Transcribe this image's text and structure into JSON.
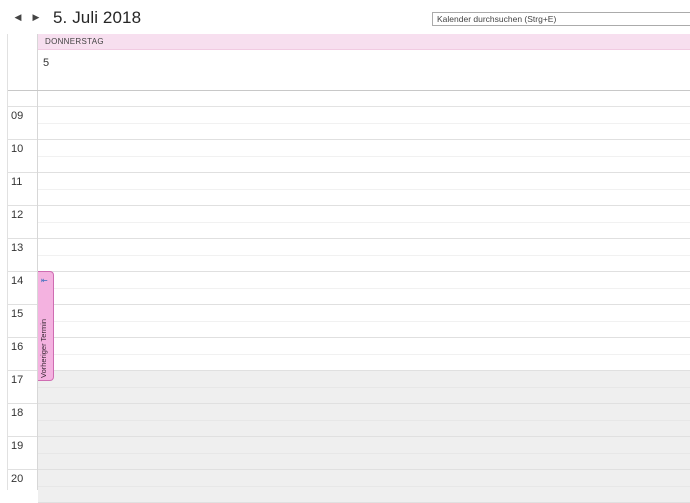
{
  "header": {
    "title": "5. Juli 2018",
    "prev_icon": "triangle-left-icon",
    "next_icon": "triangle-right-icon",
    "search_placeholder": "Kalender durchsuchen (Strg+E)"
  },
  "day": {
    "name": "DONNERSTAG",
    "number": "5",
    "header_color": "#f7dfef"
  },
  "hours": [
    "09",
    "10",
    "11",
    "12",
    "13",
    "14",
    "15",
    "16",
    "17",
    "18",
    "19",
    "20"
  ],
  "off_hours": [
    "17",
    "18",
    "19",
    "20"
  ],
  "previous_appointment": {
    "label": "Vorheriger Termin",
    "icon": "arrow-left-bar-icon",
    "color": "#f4b2e0"
  }
}
